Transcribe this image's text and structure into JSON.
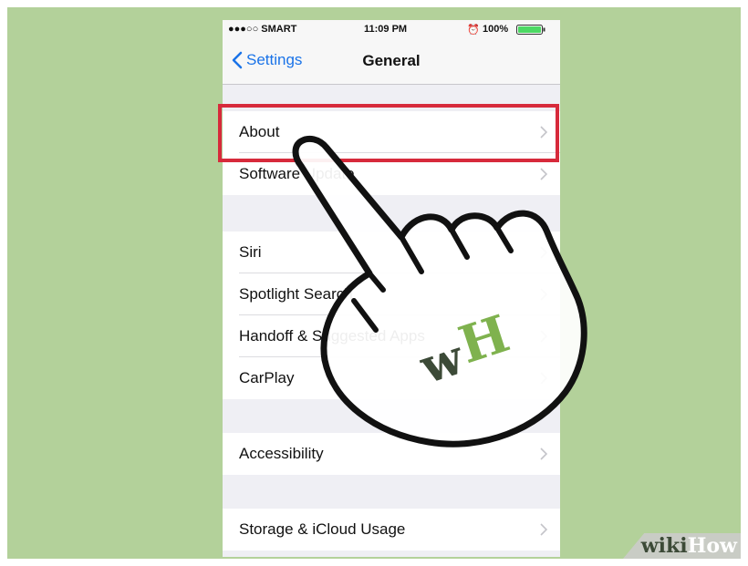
{
  "status_bar": {
    "carrier": "●●●○○ SMART",
    "time": "11:09 PM",
    "battery": "100%"
  },
  "nav": {
    "back_label": "Settings",
    "title": "General"
  },
  "groups": [
    {
      "items": [
        {
          "label": "About"
        },
        {
          "label": "Software Update"
        }
      ]
    },
    {
      "items": [
        {
          "label": "Siri"
        },
        {
          "label": "Spotlight Search"
        },
        {
          "label": "Handoff & Suggested Apps"
        },
        {
          "label": "CarPlay"
        }
      ]
    },
    {
      "items": [
        {
          "label": "Accessibility"
        }
      ]
    },
    {
      "items": [
        {
          "label": "Storage & iCloud Usage"
        }
      ]
    }
  ],
  "watermark": {
    "part1": "wiki",
    "part2": "How"
  },
  "logo_text": "wH",
  "colors": {
    "background": "#b3d19a",
    "highlight": "#d72a3b",
    "ios_blue": "#1a73e8",
    "logo_green": "#7fb24e",
    "logo_dark": "#3c4a37"
  }
}
